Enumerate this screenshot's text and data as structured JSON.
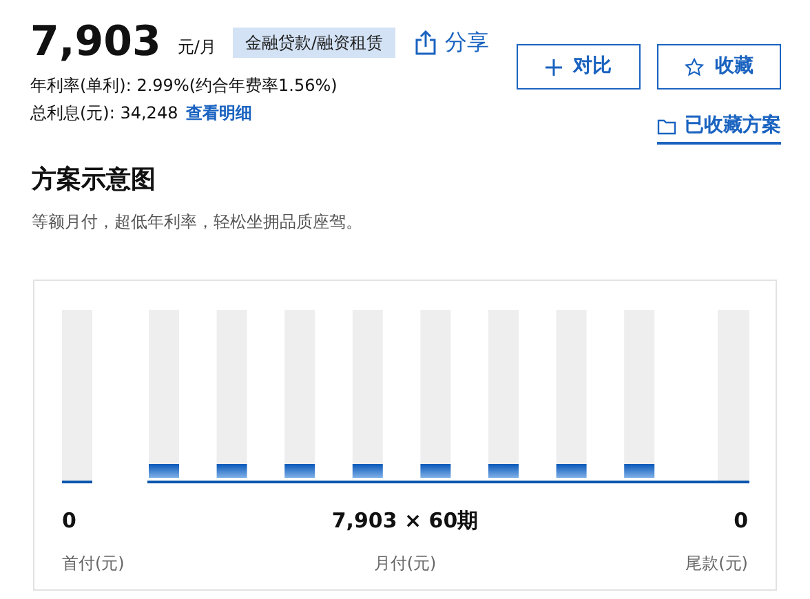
{
  "price": {
    "amount": "7,903",
    "unit": "元/月",
    "tag": "金融贷款/融资租赁"
  },
  "share": {
    "label": "分享"
  },
  "rate": {
    "label": "年利率(单利):",
    "value": "2.99%(约合年费率1.56%)"
  },
  "interest": {
    "label": "总利息(元):",
    "value": "34,248",
    "link": "查看明细"
  },
  "buttons": [
    {
      "kind": "compare",
      "label": "对比"
    },
    {
      "kind": "favorite",
      "label": "收藏"
    }
  ],
  "saved_link": {
    "label": "已收藏方案"
  },
  "section": {
    "title": "方案示意图",
    "subtitle": "等额月付，超低年利率，轻松坐拥品质座驾。"
  },
  "plan": [
    {
      "value": "0",
      "label": "首付(元)"
    },
    {
      "value": "7,903 × 60期",
      "label": "月付(元)"
    },
    {
      "value": "0",
      "label": "尾款(元)"
    }
  ]
}
